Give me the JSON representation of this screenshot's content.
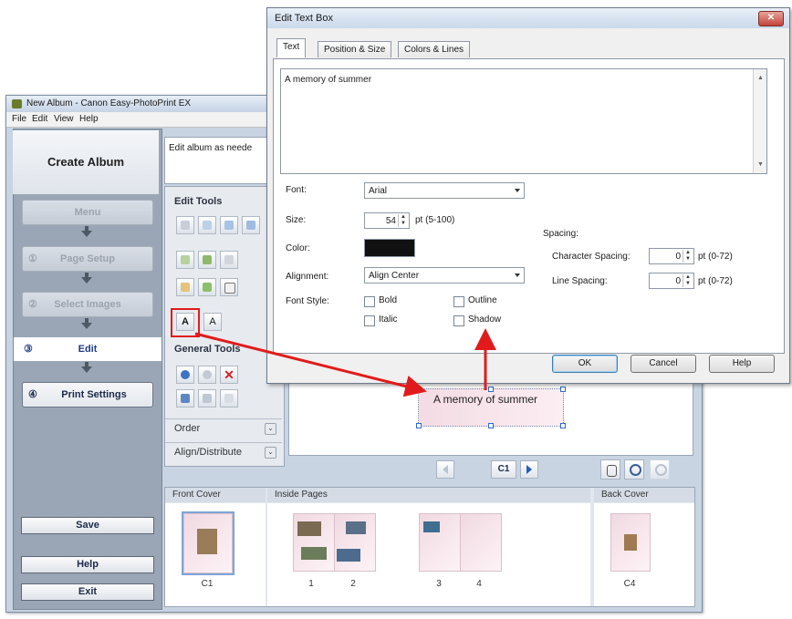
{
  "main_window": {
    "title": "New Album - Canon Easy-PhotoPrint EX",
    "menu": [
      "File",
      "Edit",
      "View",
      "Help"
    ],
    "menu_underline": [
      "F",
      "E",
      "V",
      "H"
    ]
  },
  "sidebar": {
    "title": "Create Album",
    "steps": [
      {
        "num": "",
        "label": "Menu",
        "state": "disabled"
      },
      {
        "num": "①",
        "label": "Page Setup",
        "state": "disabled"
      },
      {
        "num": "②",
        "label": "Select Images",
        "state": "disabled"
      },
      {
        "num": "③",
        "label": "Edit",
        "state": "active"
      },
      {
        "num": "④",
        "label": "Print Settings",
        "state": "normal"
      }
    ],
    "save_label": "Save",
    "help_label": "Help",
    "exit_label": "Exit"
  },
  "tools": {
    "description": "Edit album as neede",
    "edit_tools_title": "Edit Tools",
    "general_tools_title": "General Tools",
    "order_label": "Order",
    "align_label": "Align/Distribute",
    "text_icon": "A",
    "vertical_text_icon": "A"
  },
  "preview": {
    "text": "A memory of summer",
    "page_label": "C1"
  },
  "pages": {
    "front_cover_label": "Front Cover",
    "inside_pages_label": "Inside Pages",
    "back_cover_label": "Back Cover",
    "page_numbers": [
      "C1",
      "1",
      "2",
      "3",
      "4",
      "C4"
    ]
  },
  "dialog": {
    "title": "Edit Text Box",
    "tabs": [
      "Text",
      "Position & Size",
      "Colors & Lines"
    ],
    "text_value": "A memory of summer",
    "font_label": "Font:",
    "font_value": "Arial",
    "size_label": "Size:",
    "size_value": "54",
    "size_range": "pt (5-100)",
    "color_label": "Color:",
    "color_value": "#111111",
    "alignment_label": "Alignment:",
    "alignment_value": "Align Center",
    "font_style_label": "Font Style:",
    "bold_label": "Bold",
    "italic_label": "Italic",
    "outline_label": "Outline",
    "shadow_label": "Shadow",
    "spacing_label": "Spacing:",
    "char_spacing_label": "Character Spacing:",
    "char_spacing_value": "0",
    "char_spacing_range": "pt (0-72)",
    "line_spacing_label": "Line Spacing:",
    "line_spacing_value": "0",
    "line_spacing_range": "pt (0-72)",
    "ok_label": "OK",
    "cancel_label": "Cancel",
    "help_label": "Help"
  },
  "colors": {
    "annotation_red": "#e11b1b",
    "step_active_text": "#1f3c88"
  }
}
